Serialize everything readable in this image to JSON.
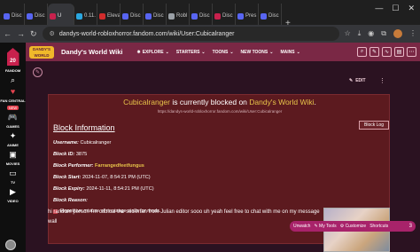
{
  "browser": {
    "tabs": [
      {
        "label": "Disc",
        "fav": "#5865f2"
      },
      {
        "label": "Disc",
        "fav": "#5865f2"
      },
      {
        "label": "U",
        "fav": "#c8214d",
        "active": true
      },
      {
        "label": "0.11.",
        "fav": "#2aa7e0"
      },
      {
        "label": "Eleva",
        "fav": "#d12c2c"
      },
      {
        "label": "Disc",
        "fav": "#5865f2"
      },
      {
        "label": "Disc",
        "fav": "#5865f2"
      },
      {
        "label": "Robl",
        "fav": "#9aa0a6"
      },
      {
        "label": "Disc",
        "fav": "#5865f2"
      },
      {
        "label": "Disc",
        "fav": "#c8214d"
      },
      {
        "label": "Pres",
        "fav": "#5865f2"
      },
      {
        "label": "Disc",
        "fav": "#5865f2"
      }
    ],
    "new_tab": "+",
    "url": "dandys-world-robloxhorror.fandom.com/wiki/User:Cubicalranger"
  },
  "rail": {
    "fandom_label": "FANDOM",
    "badge": "NEW",
    "fan_central_label": "FAN CENTRAL",
    "games_label": "GAMES",
    "anime_label": "ANIME",
    "movies_label": "MOVIES",
    "tv_label": "TV",
    "video_label": "VIDEO"
  },
  "wiki": {
    "logo_text": "DANDY'S WORLD",
    "name": "Dandy's World Wiki",
    "nav": [
      "EXPLORE",
      "STARTERS",
      "TOONS",
      "NEW TOONS",
      "MAINS"
    ]
  },
  "page": {
    "edit_label": "EDIT",
    "blocked_user": "Cubicalranger",
    "blocked_mid": " is currently blocked on ",
    "blocked_wiki": "Dandy's World Wiki",
    "blocked_end": ".",
    "blocked_url": "https://dandys-world-robloxhorror.fandom.com/wiki/User:Cubicalranger",
    "block_log": "Block Log",
    "info_title": "Block Information",
    "username_key": "Username:",
    "username_val": "Cubicalranger",
    "id_key": "Block ID:",
    "id_val": "3875",
    "performer_key": "Block Performer:",
    "performer_val": "Farrangedfeetfungus",
    "start_key": "Block Start:",
    "start_val": "2024-11-07, 8:54:21 PM (UTC)",
    "expiry_key": "Block Expiry:",
    "expiry_val": "2024-11-11, 8:54:21 PM (UTC)",
    "reason_key": "Block Reason:",
    "reason_val": "Repetitive misuse of message walls for mods.",
    "message": "hi random person I'm cubical the stickman from Julian editor sooo uh yeah feel free to chat with me on my message wall"
  },
  "pill": {
    "unwatch": "Unwatch",
    "my_tools": "My Tools",
    "customize": "Customize",
    "shortcuts": "Shortcuts",
    "count": "3"
  }
}
